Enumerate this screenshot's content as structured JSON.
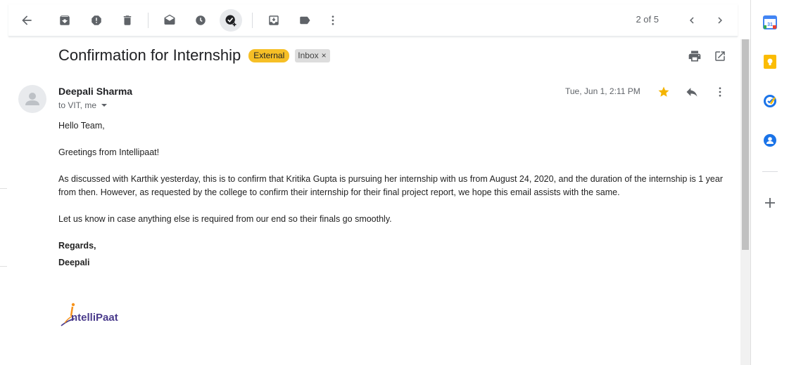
{
  "toolbar": {
    "pager_text": "2 of 5",
    "icons": [
      "back-arrow-icon",
      "archive-icon",
      "report-spam-icon",
      "delete-icon",
      "mark-unread-icon",
      "snooze-icon",
      "add-to-tasks-icon",
      "move-to-icon",
      "labels-icon",
      "more-vert-icon",
      "chevron-left-icon",
      "chevron-right-icon"
    ]
  },
  "email": {
    "subject": "Confirmation for Internship",
    "labels": {
      "external": "External",
      "inbox": "Inbox",
      "remove": "×"
    },
    "sender_name": "Deepali Sharma",
    "recipients": "to VIT, me",
    "date": "Tue, Jun 1, 2:11 PM",
    "body": {
      "greeting": "Hello Team,",
      "line2": "Greetings from Intellipaat!",
      "paragraph": "As discussed with Karthik yesterday, this is to confirm that Kritika Gupta is pursuing her internship with us from August 24, 2020, and the duration of the internship is 1 year from then. However, as requested by the college to confirm their internship for their final project report, we hope this email assists with the same.",
      "line4": "Let us know in case anything else is required from our end so their finals go smoothly.",
      "regards": "Regards,",
      "signature": "Deepali"
    },
    "logo_text": "IntelliPaat"
  },
  "side_panel": {
    "calendar_day": "31",
    "apps": [
      "calendar-icon",
      "keep-icon",
      "tasks-icon",
      "contacts-icon",
      "add-addon-icon"
    ]
  },
  "colors": {
    "external_chip": "#f6bf26",
    "star": "#f4b400",
    "keep": "#fbbc04",
    "tasks": "#1a73e8",
    "contacts": "#1a73e8",
    "logo_purple": "#4a3b8c",
    "logo_orange": "#f7941d"
  }
}
